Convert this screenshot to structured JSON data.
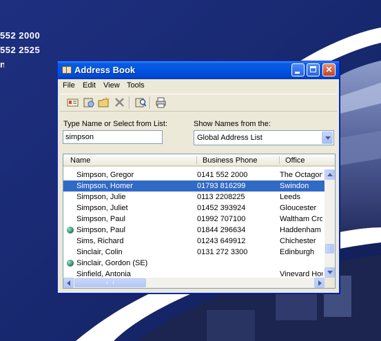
{
  "background": {
    "phone_lines": [
      "552 2000",
      "552 2525"
    ]
  },
  "window": {
    "title": "Address Book",
    "title_icon": "address-book-icon",
    "controls": [
      "minimize-icon",
      "maximize-icon",
      "close-icon"
    ]
  },
  "menu": {
    "items": [
      "File",
      "Edit",
      "View",
      "Tools"
    ]
  },
  "toolbar": {
    "icons": [
      "new-contact-icon",
      "properties-icon",
      "new-folder-icon",
      "delete-icon",
      "find-people-icon",
      "print-icon"
    ]
  },
  "search": {
    "label": "Type Name or Select from List:",
    "value": "simpson"
  },
  "source": {
    "label": "Show Names from the:",
    "selected": "Global Address List"
  },
  "list": {
    "columns": [
      "Name",
      "Business Phone",
      "Office"
    ],
    "rows": [
      {
        "name": "Simpson, Gregor",
        "phone": "0141 552 2000",
        "office": "The Octagon",
        "icon": "",
        "selected": false
      },
      {
        "name": "Simpson, Homer",
        "phone": "01793 816299",
        "office": "Swindon",
        "icon": "",
        "selected": true
      },
      {
        "name": "Simpson, Julie",
        "phone": "0113 2208225",
        "office": "Leeds",
        "icon": "",
        "selected": false
      },
      {
        "name": "Simpson, Juliet",
        "phone": "01452 393924",
        "office": "Gloucester",
        "icon": "",
        "selected": false
      },
      {
        "name": "Simpson, Paul",
        "phone": "01992 707100",
        "office": "Waltham Cros",
        "icon": "",
        "selected": false
      },
      {
        "name": "Simpson, Paul",
        "phone": "01844 296634",
        "office": "Haddenham",
        "icon": "globe-icon",
        "selected": false
      },
      {
        "name": "Sims, Richard",
        "phone": "01243 649912",
        "office": "Chichester",
        "icon": "",
        "selected": false
      },
      {
        "name": "Sinclair, Colin",
        "phone": "0131 272 3300",
        "office": "Edinburgh",
        "icon": "",
        "selected": false
      },
      {
        "name": "Sinclair, Gordon (SE)",
        "phone": "",
        "office": "",
        "icon": "globe-icon",
        "selected": false
      },
      {
        "name": "Sinfield, Antonia",
        "phone": "",
        "office": "Vinevard Hou",
        "icon": "",
        "selected": false
      }
    ]
  },
  "colors": {
    "selection": "#316ac5",
    "titlebar": "#0054e3",
    "window_bg": "#ece9d8",
    "desktop": "#1b2c78"
  }
}
